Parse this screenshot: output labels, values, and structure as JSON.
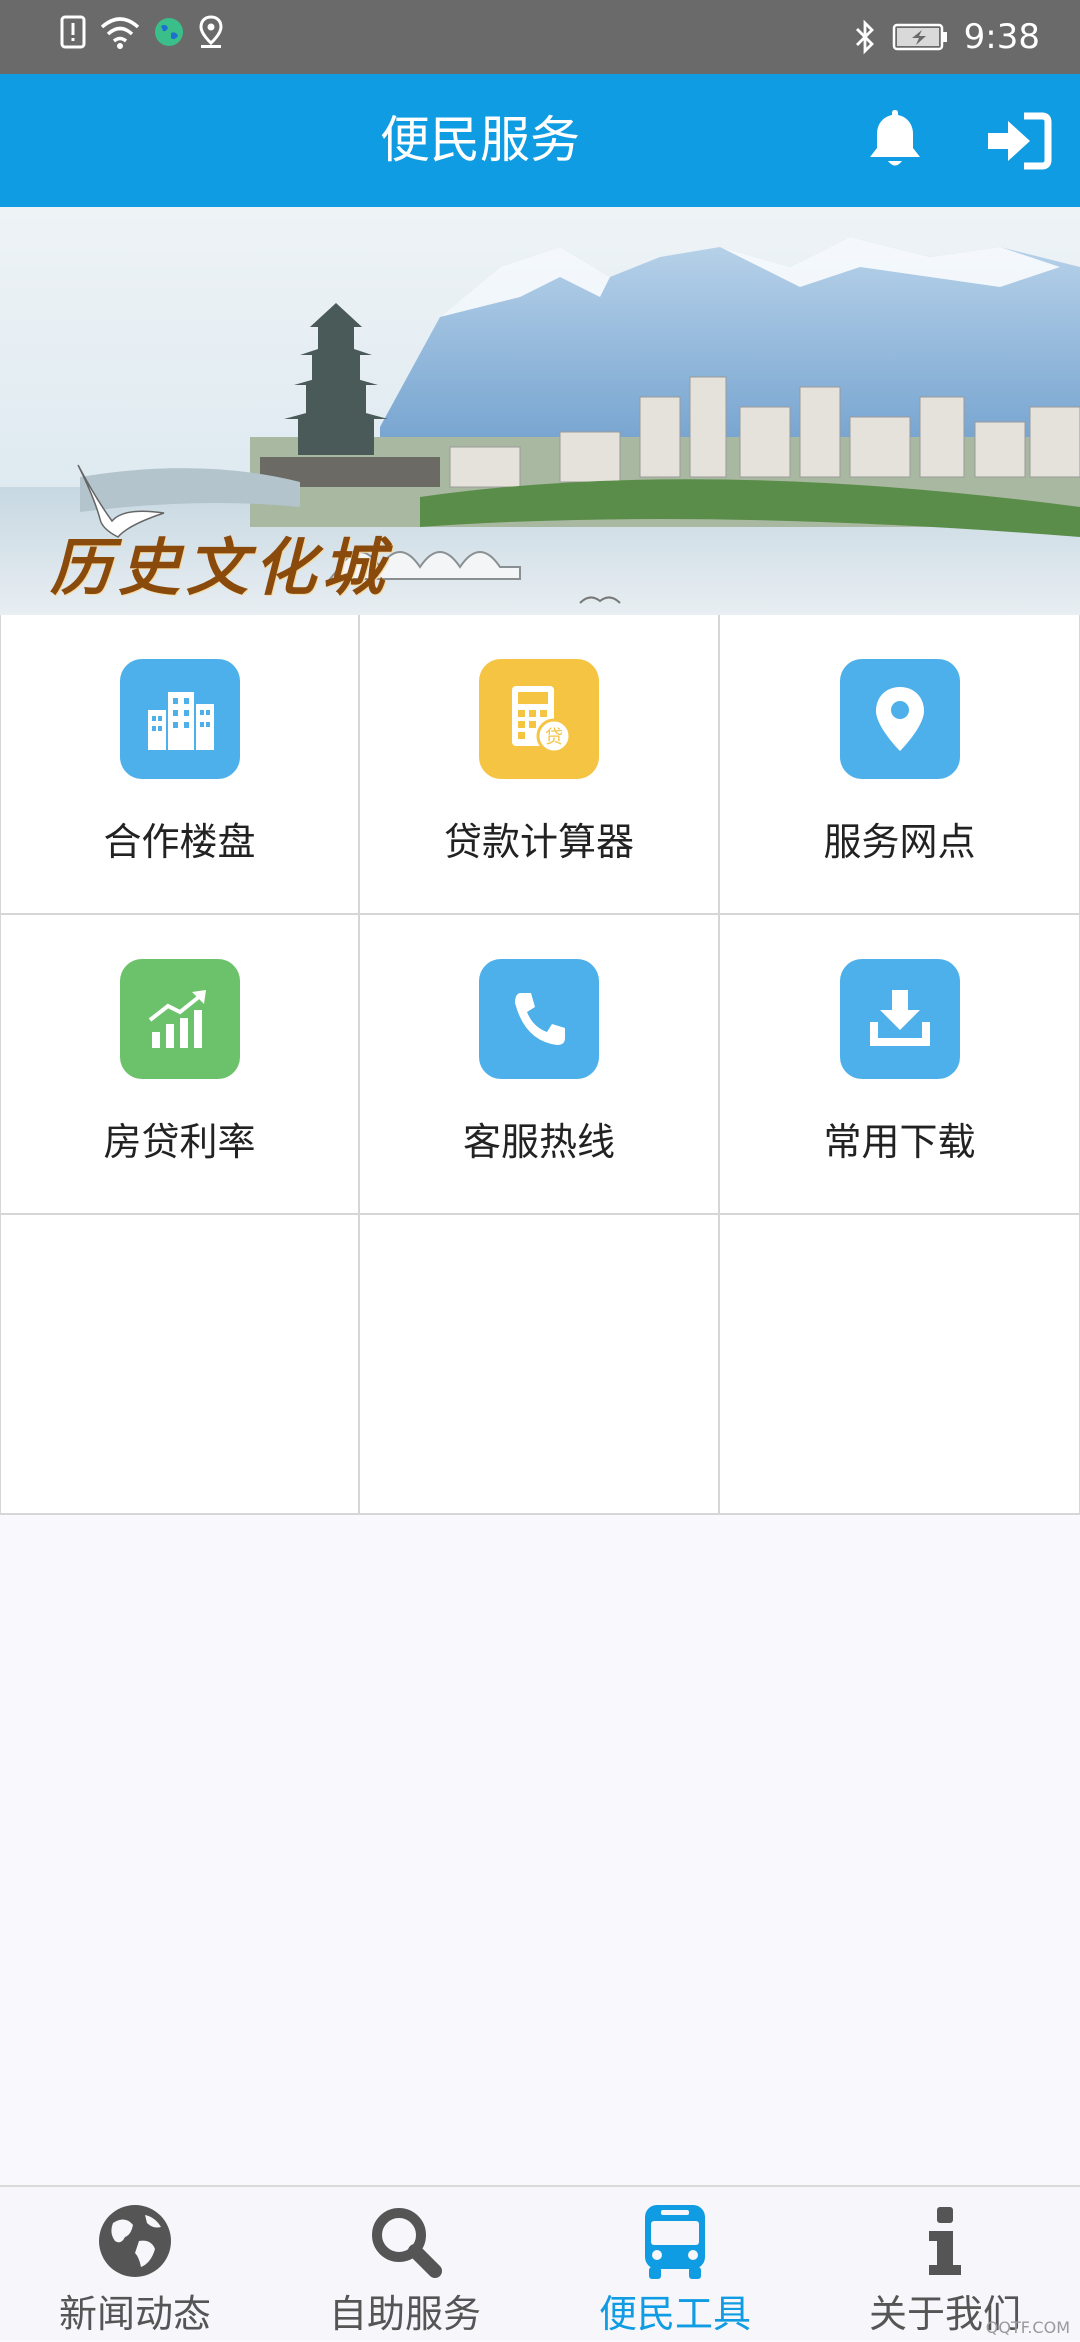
{
  "status_bar": {
    "time": "9:38"
  },
  "header": {
    "title": "便民服务"
  },
  "banner": {
    "caption": "历史文化城"
  },
  "tools": [
    {
      "label": "合作楼盘",
      "icon": "buildings-icon",
      "color": "#4db0ea"
    },
    {
      "label": "贷款计算器",
      "icon": "calculator-icon",
      "color": "#f5c443",
      "badge": "贷"
    },
    {
      "label": "服务网点",
      "icon": "location-pin-icon",
      "color": "#4db0ea"
    },
    {
      "label": "房贷利率",
      "icon": "chart-growth-icon",
      "color": "#6cc26a"
    },
    {
      "label": "客服热线",
      "icon": "phone-icon",
      "color": "#4db0ea"
    },
    {
      "label": "常用下载",
      "icon": "download-icon",
      "color": "#4db0ea"
    }
  ],
  "tabbar": {
    "items": [
      {
        "label": "新闻动态",
        "icon": "globe-icon"
      },
      {
        "label": "自助服务",
        "icon": "search-icon"
      },
      {
        "label": "便民工具",
        "icon": "bus-icon",
        "active": true
      },
      {
        "label": "关于我们",
        "icon": "info-icon"
      }
    ]
  },
  "watermark": "QQTF.COM",
  "colors": {
    "accent": "#0f9ce2",
    "status_bar": "#6a6a6a"
  }
}
